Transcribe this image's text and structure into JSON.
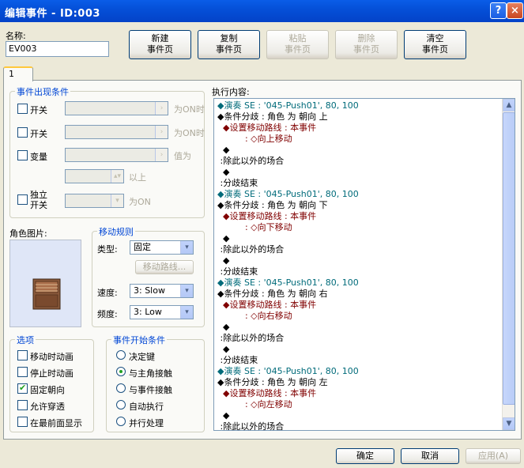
{
  "window": {
    "title": "编辑事件 - ID:003",
    "help": "?",
    "close": "×"
  },
  "name": {
    "label": "名称:",
    "value": "EV003"
  },
  "toolbar": {
    "new": "新建\n事件页",
    "copy": "复制\n事件页",
    "paste": "粘贴\n事件页",
    "delete": "删除\n事件页",
    "clear": "清空\n事件页"
  },
  "tab": {
    "label": "1"
  },
  "conditions": {
    "title": "事件出现条件",
    "switch1": "开关",
    "switch1_suffix": "为ON时",
    "switch2": "开关",
    "switch2_suffix": "为ON时",
    "variable": "变量",
    "variable_suffix": "值为",
    "variable_above": "以上",
    "self_switch": "独立\n开关",
    "self_switch_suffix": "为ON"
  },
  "graphic": {
    "label": "角色图片:"
  },
  "movement": {
    "title": "移动规则",
    "type_label": "类型:",
    "type_value": "固定",
    "route_button": "移动路线...",
    "speed_label": "速度:",
    "speed_value": "3: Slow",
    "freq_label": "频度:",
    "freq_value": "3: Low"
  },
  "options": {
    "title": "选项",
    "items": [
      {
        "label": "移动时动画",
        "checked": false
      },
      {
        "label": "停止时动画",
        "checked": false
      },
      {
        "label": "固定朝向",
        "checked": true
      },
      {
        "label": "允许穿透",
        "checked": false
      },
      {
        "label": "在最前面显示",
        "checked": false
      }
    ]
  },
  "trigger": {
    "title": "事件开始条件",
    "items": [
      {
        "label": "决定键",
        "checked": false
      },
      {
        "label": "与主角接触",
        "checked": true
      },
      {
        "label": "与事件接触",
        "checked": false
      },
      {
        "label": "自动执行",
        "checked": false
      },
      {
        "label": "并行处理",
        "checked": false
      }
    ]
  },
  "commands": {
    "label": "执行内容:",
    "lines": [
      "◆演奏 SE : '045-Push01', 80, 100",
      "◆条件分歧 : 角色 为 朝向 上",
      "  ◆设置移动路线 : 本事件",
      "          : ◇向上移动",
      "  ◆",
      " :除此以外的场合",
      "  ◆",
      " :分歧结束",
      "◆演奏 SE : '045-Push01', 80, 100",
      "◆条件分歧 : 角色 为 朝向 下",
      "  ◆设置移动路线 : 本事件",
      "          : ◇向下移动",
      "  ◆",
      " :除此以外的场合",
      "  ◆",
      " :分歧结束",
      "◆演奏 SE : '045-Push01', 80, 100",
      "◆条件分歧 : 角色 为 朝向 右",
      "  ◆设置移动路线 : 本事件",
      "          : ◇向右移动",
      "  ◆",
      " :除此以外的场合",
      "  ◆",
      " :分歧结束",
      "◆演奏 SE : '045-Push01', 80, 100",
      "◆条件分歧 : 角色 为 朝向 左",
      "  ◆设置移动路线 : 本事件",
      "          : ◇向左移动",
      "  ◆",
      " :除此以外的场合"
    ]
  },
  "footer": {
    "ok": "确定",
    "cancel": "取消",
    "apply": "应用(A)"
  }
}
